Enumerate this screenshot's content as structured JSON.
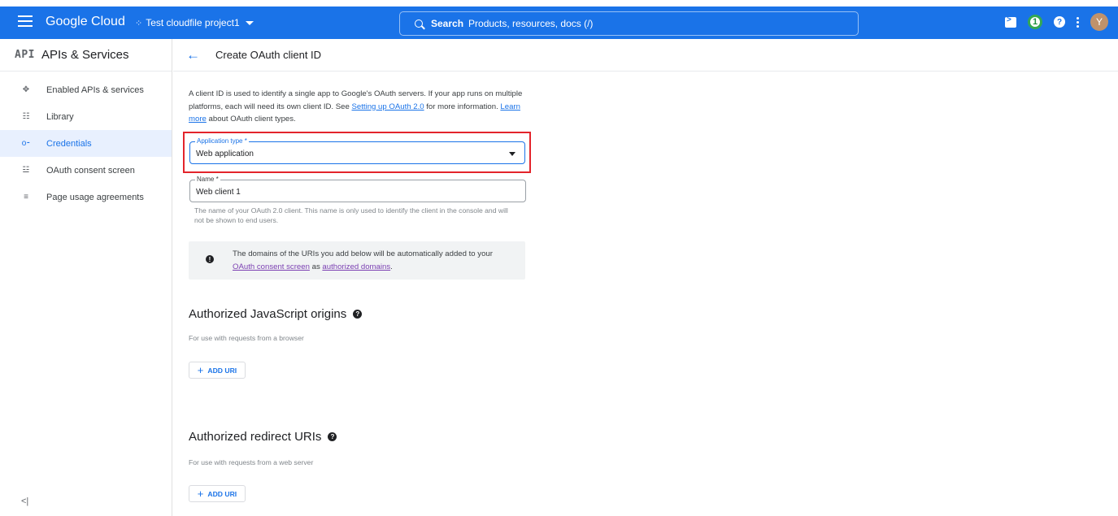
{
  "topbar": {
    "brand": "Google Cloud",
    "project": "Test cloudfile project1",
    "search_bold": "Search",
    "search_text": "Products, resources, docs (/)",
    "notification_count": "1",
    "avatar_initial": "Y",
    "colors": {
      "bar": "#1a73e8",
      "badge": "#34a853",
      "avatar": "#c0926b"
    }
  },
  "sidebar": {
    "logo": "API",
    "title": "APIs & Services",
    "items": [
      {
        "label": "Enabled APIs & services",
        "icon": "apis-icon"
      },
      {
        "label": "Library",
        "icon": "library-icon"
      },
      {
        "label": "Credentials",
        "icon": "key-icon",
        "active": true
      },
      {
        "label": "OAuth consent screen",
        "icon": "consent-icon"
      },
      {
        "label": "Page usage agreements",
        "icon": "agreements-icon"
      }
    ],
    "collapse_glyph": "<|"
  },
  "main": {
    "title": "Create OAuth client ID",
    "intro": {
      "p1": "A client ID is used to identify a single app to Google's OAuth servers. If your app runs on multiple platforms, each will need its own client ID. See ",
      "link1": "Setting up OAuth 2.0",
      "p2": " for more information. ",
      "link2": "Learn more",
      "p3": " about OAuth client types."
    },
    "application_type": {
      "label": "Application type *",
      "value": "Web application"
    },
    "name": {
      "label": "Name *",
      "value": "Web client 1",
      "helper": "The name of your OAuth 2.0 client. This name is only used to identify the client in the console and will not be shown to end users."
    },
    "info": {
      "t1": "The domains of the URIs you add below will be automatically added to your ",
      "link1": "OAuth consent screen",
      "t2": " as ",
      "link2": "authorized domains",
      "t3": "."
    },
    "js_origins": {
      "title": "Authorized JavaScript origins",
      "subtitle": "For use with requests from a browser",
      "button": "ADD URI"
    },
    "redirect_uris": {
      "title": "Authorized redirect URIs",
      "subtitle": "For use with requests from a web server",
      "button": "ADD URI"
    }
  }
}
